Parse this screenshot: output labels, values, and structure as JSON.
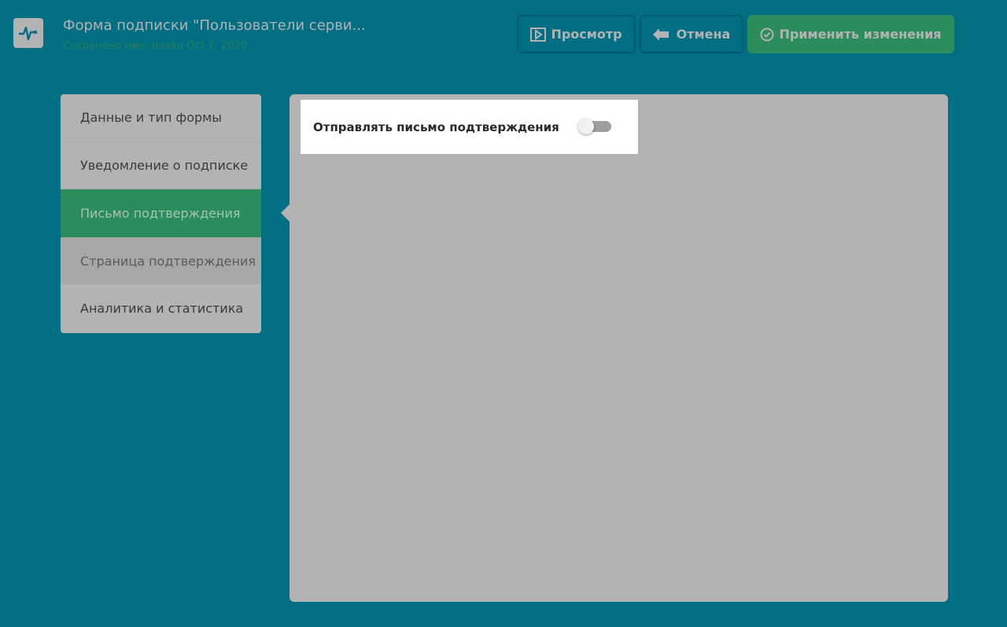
{
  "header": {
    "logo_icon": "pulse-icon",
    "title": "Форма подписки \"Пользователи серви...",
    "saved_status": "Сохранено мин. назад Oct 7, 2020",
    "buttons": {
      "preview": "Просмотр",
      "cancel": "Отмена",
      "apply": "Применить изменения"
    }
  },
  "sidebar": {
    "items": [
      {
        "label": "Данные и тип формы"
      },
      {
        "label": "Уведомление о подписке"
      },
      {
        "label": "Письмо подтверждения"
      },
      {
        "label": "Страница подтверждения"
      },
      {
        "label": "Аналитика и статистика"
      }
    ],
    "active_index": 2
  },
  "main": {
    "send_confirmation_label": "Отправлять письмо подтверждения",
    "send_confirmation_enabled": false
  },
  "colors": {
    "background": "#006f84",
    "accent": "#2b8c5c",
    "panel": "#b3b3b3"
  }
}
